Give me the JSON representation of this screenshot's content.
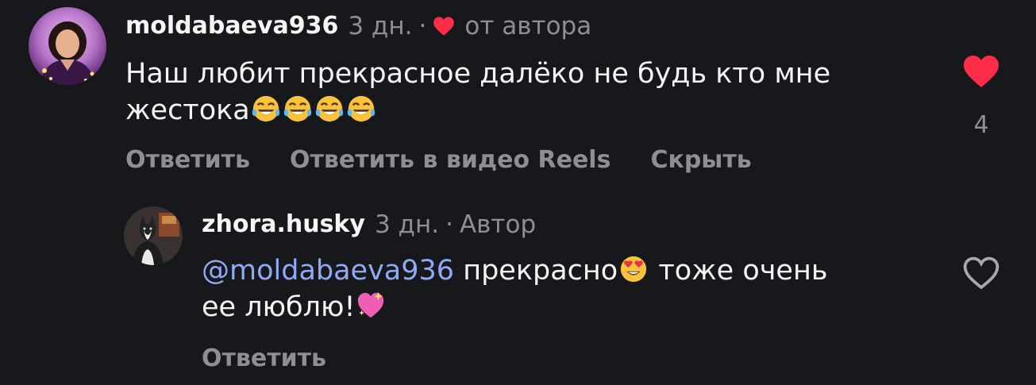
{
  "colors": {
    "background": "#17181c",
    "liked_heart": "#ff2d48",
    "mention": "#90a9f5",
    "muted": "#8e8e93"
  },
  "comments": [
    {
      "username": "moldabaeva936",
      "time": "3 дн.",
      "separator": "·",
      "author_like_icon": "red-heart-icon",
      "author_like_label": "от автора",
      "text_line1": "Наш любит прекрасное далёко не будь кто мне",
      "text_line2": "жестока",
      "trailing_emojis": [
        "tears-of-joy-emoji",
        "tears-of-joy-emoji",
        "tears-of-joy-emoji",
        "tears-of-joy-emoji"
      ],
      "liked": true,
      "like_icon": "filled-heart-icon",
      "like_count": "4",
      "actions": {
        "reply": "Ответить",
        "reply_reels": "Ответить в видео Reels",
        "hide": "Скрыть"
      }
    },
    {
      "username": "zhora.husky",
      "time": "3 дн.",
      "separator": "·",
      "role": "Автор",
      "mention": "@moldabaeva936",
      "text_part1": "прекрасно",
      "text_part1_emoji": "heart-eyes-emoji",
      "text_part2": "тоже очень",
      "text_line2": "ее люблю!",
      "text_line2_emoji": "sparkling-heart-emoji",
      "liked": false,
      "like_icon": "outline-heart-icon",
      "actions": {
        "reply": "Ответить"
      }
    }
  ]
}
